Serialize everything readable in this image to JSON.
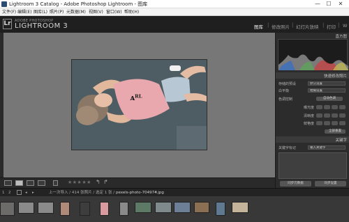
{
  "window": {
    "title": "Lightroom 3 Catalog - Adobe Photoshop Lightroom - 图库",
    "minimize": "—",
    "maximize": "☐",
    "close": "✕"
  },
  "menubar": {
    "items": [
      "文件(F)",
      "编辑(E)",
      "图库(L)",
      "照片(P)",
      "元数据(M)",
      "视图(V)",
      "窗口(W)",
      "帮助(H)"
    ]
  },
  "header": {
    "logo": "Lr",
    "brand_small": "ADOBE PHOTOSHOP",
    "brand_big": "LIGHTROOM 3",
    "modules": [
      "图库",
      "修改照片",
      "幻灯片放映",
      "打印",
      "W"
    ],
    "active_module": "图库",
    "separator": "|"
  },
  "right_panel": {
    "histogram_title": "直方图",
    "quick_develop_title": "快速修改照片",
    "saved_preset_label": "存储的预设",
    "saved_preset_value": "默认设置",
    "white_balance_label": "白平衡",
    "white_balance_value": "拍摄设置",
    "tone_control_label": "色调控制",
    "auto_tone_button": "自动色调",
    "exposure_label": "曝光度",
    "clarity_label": "清晰度",
    "vibrance_label": "鲜艳度",
    "reset_button": "全部重置",
    "keywords_title": "关键字",
    "keyword_tags_label": "关键字标记",
    "keyword_tags_value": "输入关键字",
    "sync_metadata_button": "同步元数据",
    "sync_settings_button": "同步设置"
  },
  "toolbar": {
    "stars": "★★★★★",
    "rotate_left": "↰",
    "rotate_right": "↱"
  },
  "filmbar": {
    "page_num": "1",
    "page_num_2": "2",
    "nav_text": "上一次导入 / 414 张照片 / 选定 1 张 /",
    "filename": "pexels-photo-704974.jpg",
    "dropdown": "▾"
  },
  "colors": {
    "header_bg": "#1f1f1f",
    "panel_bg": "#2c2c2c",
    "center_bg": "#777777",
    "accent_active": "#f0f0f0"
  }
}
